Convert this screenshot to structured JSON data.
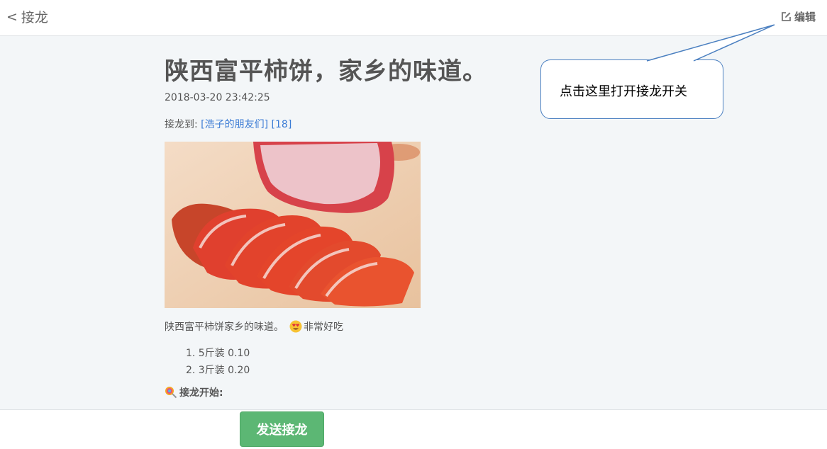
{
  "header": {
    "back_chevron": "<",
    "back_label": "接龙",
    "edit_label": "编辑",
    "edit_icon": "edit-square-icon"
  },
  "post": {
    "title": "陕西富平柿饼，家乡的味道。",
    "timestamp": "2018-03-20 23:42:25",
    "target_prefix": "接龙到:",
    "target_group": "[浩子的朋友们] [18]",
    "image": "dried-persimmon-photo",
    "description_text": "陕西富平柿饼家乡的味道。",
    "description_emoji": "heart-eyes-emoji",
    "description_suffix": "非常好吃",
    "options": [
      "1. 5斤装 0.10",
      "2. 3斤装 0.20"
    ],
    "start_icon": "lollipop-icon",
    "start_label": "接龙开始:"
  },
  "footer": {
    "send_button_label": "发送接龙"
  },
  "annotation": {
    "callout_text": "点击这里打开接龙开关",
    "border_color": "#4a7fc0"
  },
  "colors": {
    "page_bg": "#f3f6f8",
    "link": "#3a7bd5",
    "button": "#5cb774",
    "text": "#555555"
  }
}
